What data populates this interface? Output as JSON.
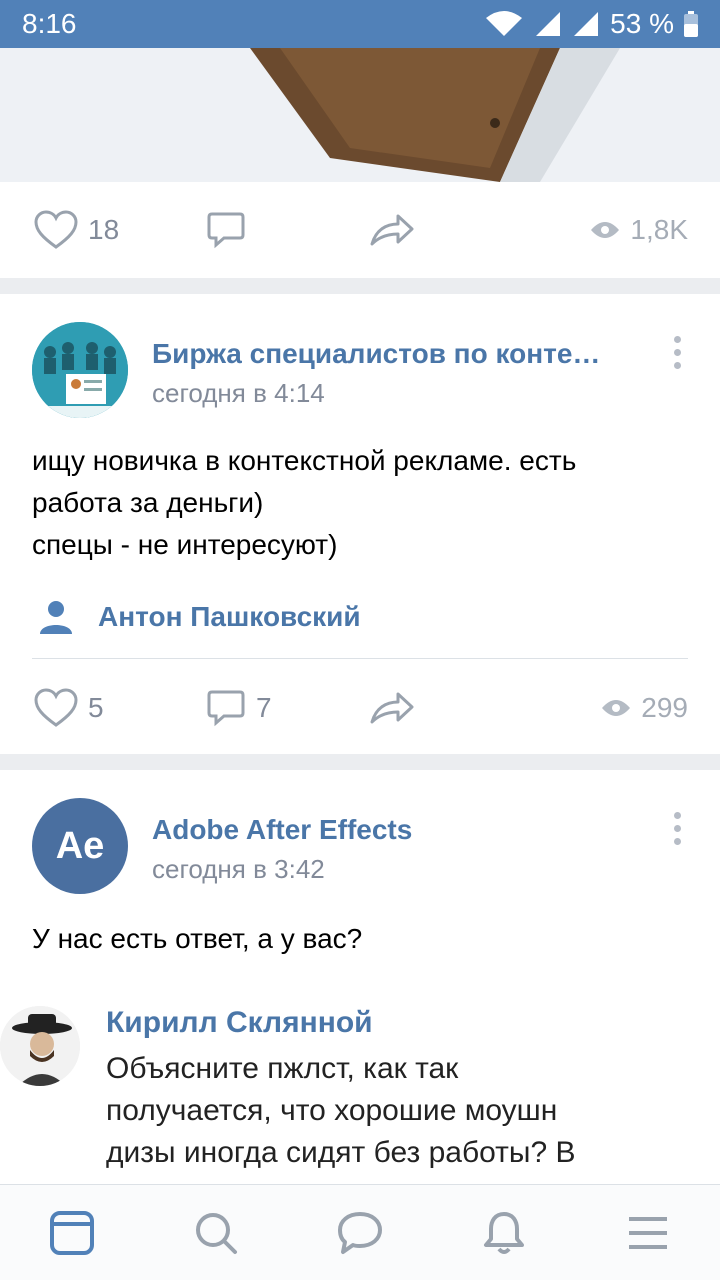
{
  "status_bar": {
    "time": "8:16",
    "battery": "53 %"
  },
  "post1": {
    "likes": "18",
    "views": "1,8K"
  },
  "post2": {
    "author": "Биржа специалистов по конте…",
    "time": "сегодня в 4:14",
    "text_lines": [
      "ищу новичка в контекстной рекламе. есть",
      "работа за деньги)",
      "спецы - не интересуют)"
    ],
    "signer": "Антон Пашковский",
    "likes": "5",
    "comments": "7",
    "views": "299"
  },
  "post3": {
    "author": "Adobe After Effects",
    "avatar_text": "Ae",
    "time": "сегодня в 3:42",
    "text": "У нас есть ответ, а у вас?",
    "comment": {
      "author": "Кирилл Склянной",
      "lines": [
        "Объясните пжлст, как так",
        "получается, что хорошие моушн",
        "дизы иногда сидят без работы? В"
      ]
    }
  },
  "colors": {
    "accent": "#5181b8",
    "link": "#4a76a8",
    "muted": "#828a99"
  }
}
